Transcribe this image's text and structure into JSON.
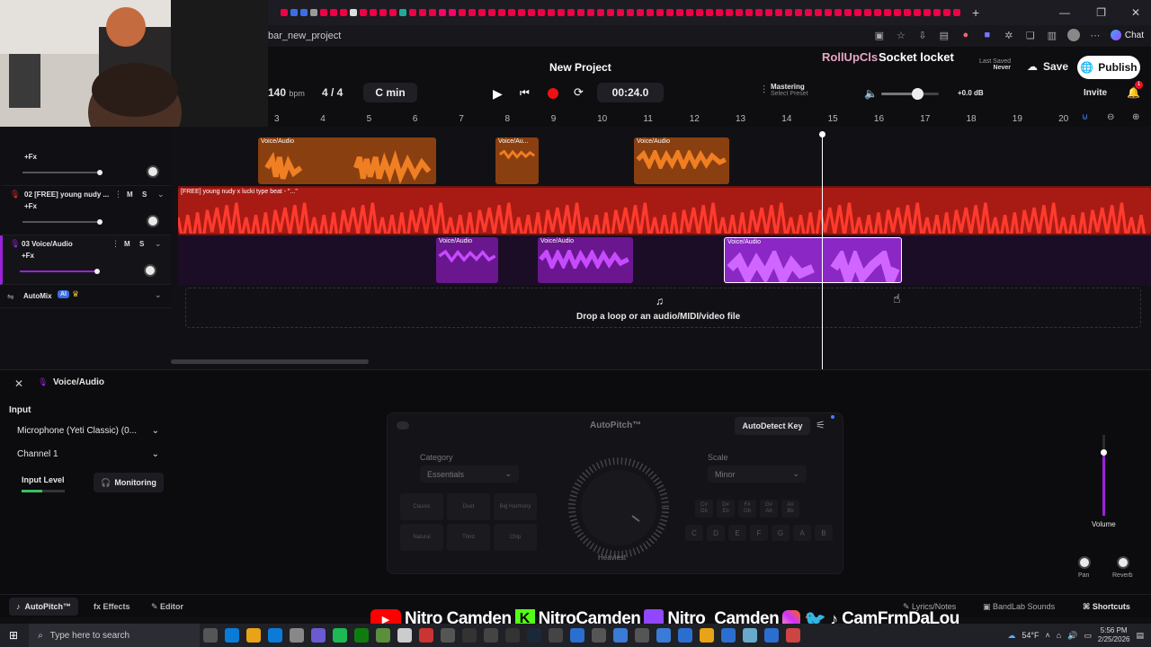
{
  "browser": {
    "url": "bar_new_project",
    "chat_label": "Chat"
  },
  "header": {
    "project_title": "New Project",
    "user_name": "RollUpCls",
    "song_name": "Socket locket",
    "last_saved_label": "Last Saved",
    "last_saved_value": "Never",
    "save_label": "Save",
    "publish_label": "Publish",
    "invite_label": "Invite",
    "notification_count": "1"
  },
  "transport": {
    "bpm": "140",
    "bpm_unit": "bpm",
    "time_sig": "4 / 4",
    "key": "C min",
    "time": "00:24.0",
    "mastering_label": "Mastering",
    "select_preset": "Select Preset",
    "master_db": "+0.0 dB",
    "master_volume": 0.62
  },
  "ruler": [
    "3",
    "4",
    "5",
    "6",
    "7",
    "8",
    "9",
    "10",
    "11",
    "12",
    "13",
    "14",
    "15",
    "16",
    "17",
    "18",
    "19",
    "20"
  ],
  "tracks": [
    {
      "id": "t1",
      "name": "",
      "fx_label": "+Fx",
      "color": "#ef7f22",
      "volume": 0.82,
      "clips": [
        {
          "label": "Voice/Audio"
        },
        {
          "label": "Voice/Au..."
        },
        {
          "label": "Voice/Audio"
        }
      ]
    },
    {
      "id": "t2",
      "name": "02  [FREE] young nudy ...",
      "fx_label": "+Fx",
      "m": "M",
      "s": "S",
      "color": "#e12b20",
      "volume": 0.82,
      "clips": [
        {
          "label": "[FREE] young nudy x lucki type beat - \"...\""
        }
      ]
    },
    {
      "id": "t3",
      "name": "03  Voice/Audio",
      "fx_label": "+Fx",
      "m": "M",
      "s": "S",
      "color": "#9b22d8",
      "volume": 0.82,
      "clips": [
        {
          "label": "Voice/Audio"
        },
        {
          "label": "Voice/Audio"
        },
        {
          "label": "Voice/Audio"
        }
      ]
    }
  ],
  "automix": {
    "label": "AutoMix",
    "ai": "AI"
  },
  "dropzone": {
    "text": "Drop a loop or an audio/MIDI/video file"
  },
  "panel": {
    "title": "Voice/Audio",
    "input_label": "Input",
    "input_device": "Microphone (Yeti Classic) (0...",
    "channel": "Channel 1",
    "input_level_label": "Input Level",
    "monitoring_label": "Monitoring",
    "autopitch_title": "AutoPitch™",
    "autodetect_label": "AutoDetect Key",
    "category_label": "Category",
    "category_value": "Essentials",
    "scale_label": "Scale",
    "scale_value": "Minor",
    "knob_label": "Heaviest",
    "presets": [
      "Classic",
      "Duet",
      "Big Harmony",
      "Natural",
      "Third",
      "Chip"
    ],
    "keys_row1": [
      "C#\nDb",
      "D#\nEb",
      "F#\nGb",
      "G#\nAb",
      "A#\nBb"
    ],
    "keys_row2": [
      "C",
      "D",
      "E",
      "F",
      "G",
      "A",
      "B"
    ],
    "volume_label": "Volume",
    "pan_label": "Pan",
    "reverb_label": "Reverb"
  },
  "footer": {
    "autopitch": "AutoPitch™",
    "effects": "Effects",
    "editor": "Editor",
    "lyrics": "Lyrics/Notes",
    "sounds": "BandLab Sounds",
    "shortcuts": "Shortcuts"
  },
  "social": {
    "youtube": "Nitro Camden",
    "kick": "NitroCamden",
    "twitch": "Nitro_Camden",
    "other": "CamFrmDaLou"
  },
  "taskbar": {
    "search_placeholder": "Type here to search",
    "weather": "54°F",
    "time": "5:56 PM",
    "date": "2/25/2026"
  },
  "colors": {
    "orange": "#ef7f22",
    "red": "#e12b20",
    "purple": "#9b22d8",
    "accent": "#4d7cff"
  }
}
